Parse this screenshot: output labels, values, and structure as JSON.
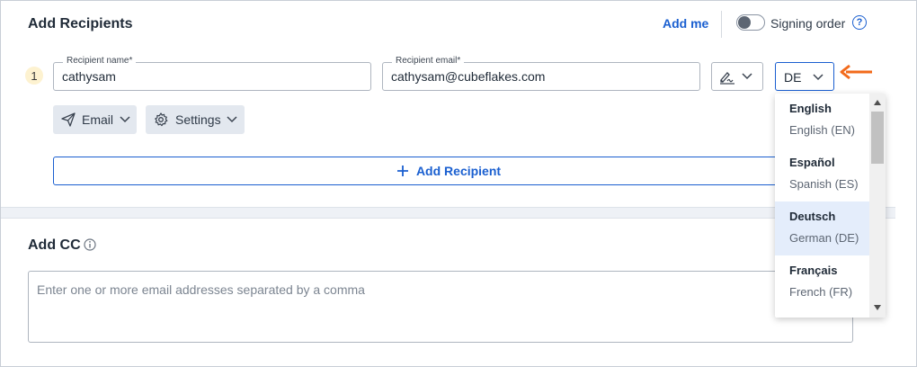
{
  "recipients": {
    "title": "Add Recipients",
    "add_me": "Add me",
    "signing_order_label": "Signing order",
    "help_glyph": "?",
    "items": [
      {
        "number": "1",
        "name_label": "Recipient name*",
        "name_value": "cathysam",
        "email_label": "Recipient email*",
        "email_value": "cathysam@cubeflakes.com",
        "role_icon": "signature-icon",
        "language_value": "DE",
        "delivery_label": "Email",
        "settings_label": "Settings"
      }
    ],
    "add_recipient_label": "Add Recipient"
  },
  "language_dropdown": {
    "options": [
      {
        "name": "English",
        "sub": "English (EN)",
        "selected": false
      },
      {
        "name": "Español",
        "sub": "Spanish (ES)",
        "selected": false
      },
      {
        "name": "Deutsch",
        "sub": "German (DE)",
        "selected": true
      },
      {
        "name": "Français",
        "sub": "French (FR)",
        "selected": false
      }
    ]
  },
  "cc": {
    "title": "Add CC",
    "placeholder": "Enter one or more email addresses separated by a comma"
  },
  "colors": {
    "accent": "#1a5fd0",
    "annotation_arrow": "#f26a1b",
    "selected_option_bg": "#e4edfb"
  }
}
